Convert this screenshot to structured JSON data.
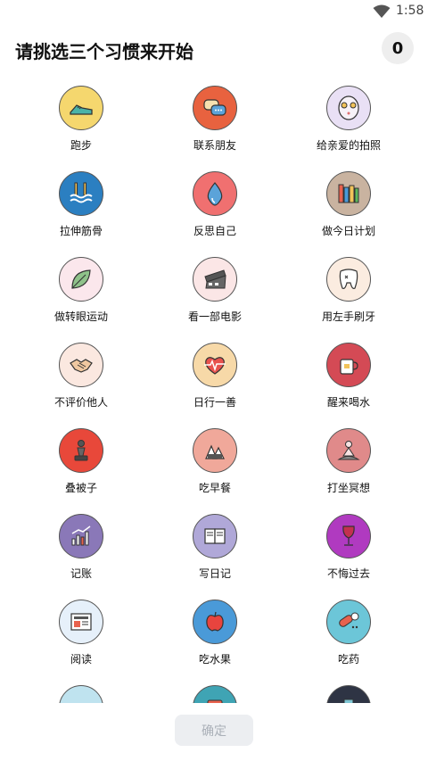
{
  "status_bar": {
    "time": "1:58",
    "wifi_icon": "wifi-icon"
  },
  "header": {
    "title": "请挑选三个习惯来开始",
    "counter": "0"
  },
  "habits": [
    {
      "label": "跑步",
      "icon": "shoe-icon",
      "color": "#f5d76e"
    },
    {
      "label": "联系朋友",
      "icon": "chat-bubbles-icon",
      "color": "#e8623f"
    },
    {
      "label": "给亲爱的拍照",
      "icon": "face-mask-icon",
      "color": "#e9e0f5"
    },
    {
      "label": "拉伸筋骨",
      "icon": "swimming-pool-icon",
      "color": "#2b7fc1"
    },
    {
      "label": "反思自己",
      "icon": "water-drop-icon",
      "color": "#f07070"
    },
    {
      "label": "做今日计划",
      "icon": "books-icon",
      "color": "#c9b3a0"
    },
    {
      "label": "做转眼运动",
      "icon": "leaf-icon",
      "color": "#fbe7ec"
    },
    {
      "label": "看一部电影",
      "icon": "film-strip-icon",
      "color": "#fbe6e6"
    },
    {
      "label": "用左手刷牙",
      "icon": "tooth-icon",
      "color": "#fbece0"
    },
    {
      "label": "不评价他人",
      "icon": "handshake-icon",
      "color": "#fbe8e0"
    },
    {
      "label": "日行一善",
      "icon": "heartbeat-icon",
      "color": "#f7d9a8"
    },
    {
      "label": "醒来喝水",
      "icon": "mug-icon",
      "color": "#d44a55"
    },
    {
      "label": "叠被子",
      "icon": "chess-piece-icon",
      "color": "#e8483a"
    },
    {
      "label": "吃早餐",
      "icon": "rice-balls-icon",
      "color": "#f0a89a"
    },
    {
      "label": "打坐冥想",
      "icon": "meditation-icon",
      "color": "#e08a8a"
    },
    {
      "label": "记账",
      "icon": "finance-chart-icon",
      "color": "#8a78b8"
    },
    {
      "label": "写日记",
      "icon": "notebook-icon",
      "color": "#b0a8d8"
    },
    {
      "label": "不悔过去",
      "icon": "wine-glass-icon",
      "color": "#b03ac0"
    },
    {
      "label": "阅读",
      "icon": "newspaper-icon",
      "color": "#e6f0fa"
    },
    {
      "label": "吃水果",
      "icon": "apple-icon",
      "color": "#4a9ad8"
    },
    {
      "label": "吃药",
      "icon": "pills-icon",
      "color": "#6cc6d8"
    },
    {
      "label": "",
      "icon": "bandage-icon",
      "color": "#bfe3ef"
    },
    {
      "label": "",
      "icon": "jar-icon",
      "color": "#3fa4b4"
    },
    {
      "label": "",
      "icon": "door-icon",
      "color": "#2e3444"
    }
  ],
  "footer": {
    "confirm_label": "确定"
  }
}
